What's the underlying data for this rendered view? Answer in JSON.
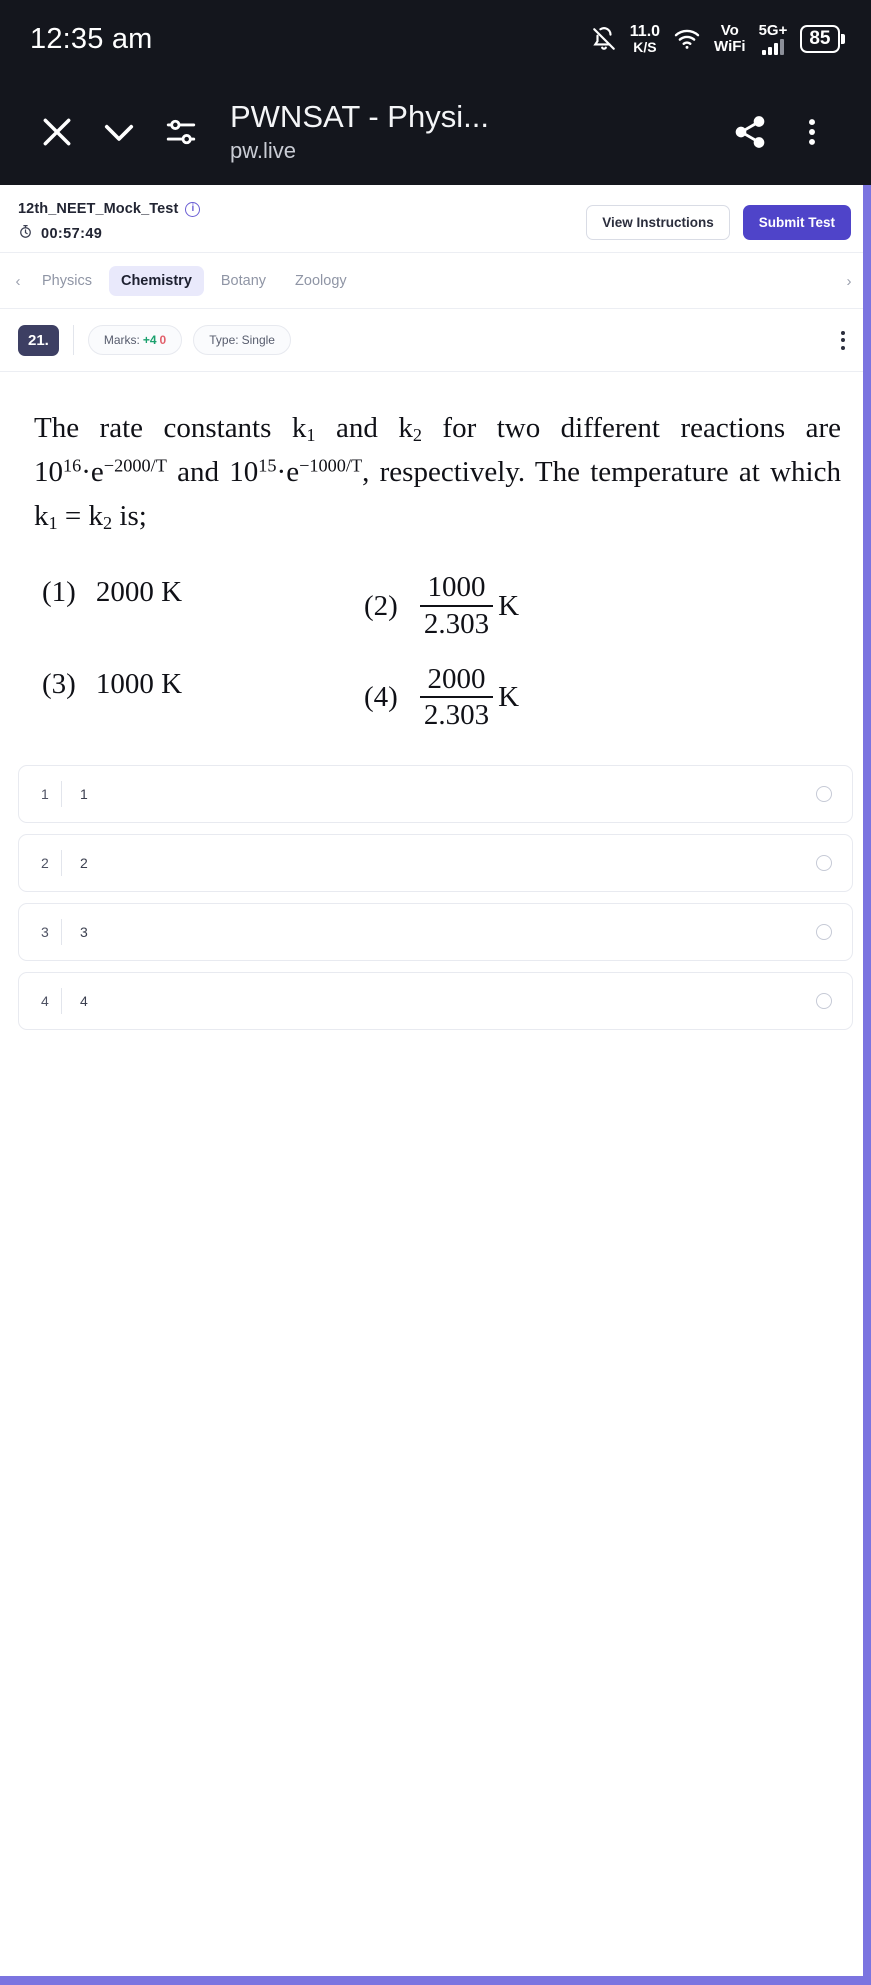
{
  "status_bar": {
    "time": "12:35 am",
    "network_speed_value": "11.0",
    "network_speed_unit": "K/S",
    "vo_label_top": "Vo",
    "vo_label_bottom": "WiFi",
    "network_gen": "5G+",
    "battery_percent": "85",
    "icons": [
      "notifications-off-icon",
      "network-speed-icon",
      "wifi-icon",
      "vowifi-icon",
      "cellular-signal-icon",
      "battery-icon"
    ]
  },
  "browser_bar": {
    "title": "PWNSAT - Physi...",
    "url": "pw.live",
    "icons": [
      "close-icon",
      "chevron-down-icon",
      "tune-icon",
      "share-icon",
      "overflow-menu-icon"
    ]
  },
  "test_header": {
    "test_name": "12th_NEET_Mock_Test",
    "info_glyph": "i",
    "timer": "00:57:49",
    "view_instructions_label": "View Instructions",
    "submit_test_label": "Submit Test",
    "accent_color": "#4f44c9"
  },
  "subject_tabs": {
    "prev_arrow": "‹",
    "next_arrow": "›",
    "items": [
      {
        "label": "Physics",
        "active": false
      },
      {
        "label": "Chemistry",
        "active": true
      },
      {
        "label": "Botany",
        "active": false
      },
      {
        "label": "Zoology",
        "active": false
      }
    ]
  },
  "question_meta": {
    "number": "21.",
    "marks_label": "Marks:",
    "marks_positive": "+4",
    "marks_negative": "0",
    "type_label": "Type:",
    "type_value": "Single",
    "menu_icon": "overflow-menu-icon"
  },
  "question": {
    "line1_a": "The rate constants k",
    "sub1": "1",
    "line1_b": " and k",
    "sub2": "2",
    "line1_c": " for two different reactions are 10",
    "sup16": "16",
    "line1_d": "·e",
    "sup_e1": "−2000/T",
    "line1_e": " and 10",
    "sup15": "15",
    "line1_f": "·e",
    "sup_e2": "−1000/T",
    "line1_g": ", respectively. The temperature at which k",
    "sub3": "1",
    "line1_h": " = k",
    "sub4": "2",
    "line1_i": " is;",
    "options": [
      {
        "mark": "(1)",
        "kind": "plain",
        "text": "2000 K"
      },
      {
        "mark": "(2)",
        "kind": "fraction",
        "numerator": "1000",
        "denominator": "2.303",
        "unit": "K"
      },
      {
        "mark": "(3)",
        "kind": "plain",
        "text": "1000 K"
      },
      {
        "mark": "(4)",
        "kind": "fraction",
        "numerator": "2000",
        "denominator": "2.303",
        "unit": "K"
      }
    ]
  },
  "answer_list": [
    {
      "index": "1",
      "label": "1",
      "selected": false
    },
    {
      "index": "2",
      "label": "2",
      "selected": false
    },
    {
      "index": "3",
      "label": "3",
      "selected": false
    },
    {
      "index": "4",
      "label": "4",
      "selected": false
    }
  ],
  "scrollbars": {
    "color": "#7b74e0"
  }
}
